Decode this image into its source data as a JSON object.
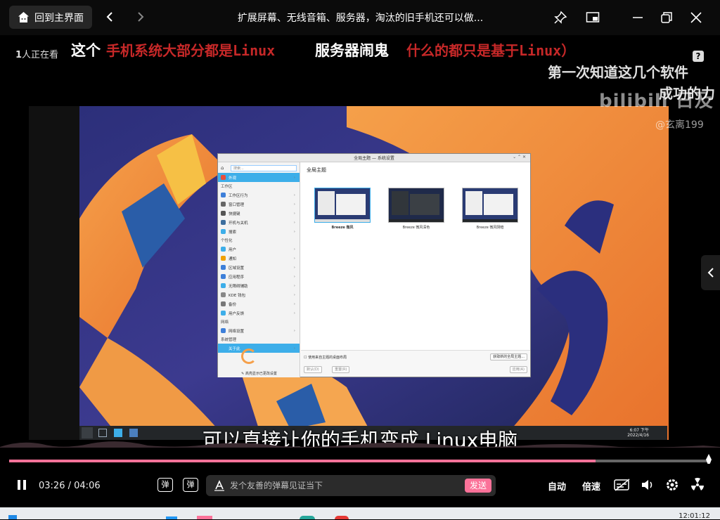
{
  "titlebar": {
    "home_label": "回到主界面",
    "window_title": "扩展屏幕、无线音箱、服务器，淘汰的旧手机还可以做...",
    "icons": [
      "home-icon",
      "back-icon",
      "forward-icon",
      "pin-icon",
      "mini-window-icon",
      "minimize-icon",
      "restore-icon",
      "close-icon"
    ]
  },
  "viewer": {
    "watching_count": "1",
    "watching_text": "人正在看",
    "danmaku": [
      {
        "text": "这个",
        "color": "#ffffff"
      },
      {
        "text": "手机系统大部分都是Linux",
        "color": "#c62828"
      },
      {
        "text": "服务器闹鬼",
        "color": "#ffffff"
      },
      {
        "text": "什么的都只是基于Linux）",
        "color": "#c62828"
      },
      {
        "text": "第一次知道这几个软件",
        "color": "#e0e0e0"
      },
      {
        "text": "成功的力",
        "color": "#e0e0e0"
      }
    ],
    "watermark_logo": "bilibili 日及",
    "watermark_user": "@玄离199",
    "subtitle": "可以直接让你的手机变成 Linux电脑",
    "help_label": "?"
  },
  "kde": {
    "window_title": "全局主题 — 系统设置",
    "search_placeholder": "搜索...",
    "heading": "全局主题",
    "sidebar": [
      {
        "type": "item",
        "label": "外观",
        "color": "#e84f3d",
        "active": true
      },
      {
        "type": "cat",
        "label": "工作区"
      },
      {
        "type": "item",
        "label": "工作区行为",
        "color": "#3d7fd9"
      },
      {
        "type": "item",
        "label": "窗口管理",
        "color": "#666666"
      },
      {
        "type": "item",
        "label": "快捷键",
        "color": "#555555"
      },
      {
        "type": "item",
        "label": "开机与关机",
        "color": "#3d6e9e"
      },
      {
        "type": "item",
        "label": "搜索",
        "color": "#3daee9"
      },
      {
        "type": "cat",
        "label": "个性化"
      },
      {
        "type": "item",
        "label": "用户",
        "color": "#3daee9"
      },
      {
        "type": "item",
        "label": "通知",
        "color": "#f0a000"
      },
      {
        "type": "item",
        "label": "区域设置",
        "color": "#3d7fd9"
      },
      {
        "type": "item",
        "label": "应用程序",
        "color": "#3d7fd9"
      },
      {
        "type": "item",
        "label": "无障碍辅助",
        "color": "#3daee9"
      },
      {
        "type": "item",
        "label": "KDE 钱包",
        "color": "#888888"
      },
      {
        "type": "item",
        "label": "备份",
        "color": "#777777"
      },
      {
        "type": "item",
        "label": "用户反馈",
        "color": "#3daee9"
      },
      {
        "type": "cat",
        "label": "网络"
      },
      {
        "type": "item",
        "label": "网络设置",
        "color": "#3d7fd9"
      },
      {
        "type": "cat",
        "label": "系统管理"
      },
      {
        "type": "item",
        "label": "关于此",
        "color": "#3daee9",
        "active": true
      }
    ],
    "highlight_changed": "高亮显示已更改设置",
    "themes": [
      {
        "name": "Breeze 微风",
        "selected": true
      },
      {
        "name": "Breeze 微风深色",
        "selected": false
      },
      {
        "name": "Breeze 微风阴暗",
        "selected": false
      }
    ],
    "use_desktop_layout": "使用来自主题的桌面布局",
    "get_new": "获取新的全局主题...",
    "btn_default": "默认(D)",
    "btn_reset": "重置(R)",
    "btn_apply": "应用(A)",
    "clock_time": "6:07 下午",
    "clock_date": "2022/4/16"
  },
  "player": {
    "progress": 0.836,
    "buffered": 0.997,
    "current_time": "03:26",
    "separator": "/",
    "total_time": "04:06",
    "danmaku_placeholder": "发个友善的弹幕见证当下",
    "send_label": "发送",
    "auto_label": "自动",
    "speed_label": "倍速",
    "danmaku_on_icon": "弹",
    "danmaku_settings_icon": "弹",
    "icons": [
      "pause-icon",
      "danmaku-toggle-icon",
      "danmaku-settings-icon",
      "text-style-icon",
      "subtitle-icon",
      "volume-icon",
      "settings-icon",
      "radiation-icon"
    ]
  },
  "taskbar_clock": "12:01:12",
  "colors": {
    "accent": "#fb7299",
    "background": "#000000",
    "titlebar": "#0b0b0b"
  }
}
